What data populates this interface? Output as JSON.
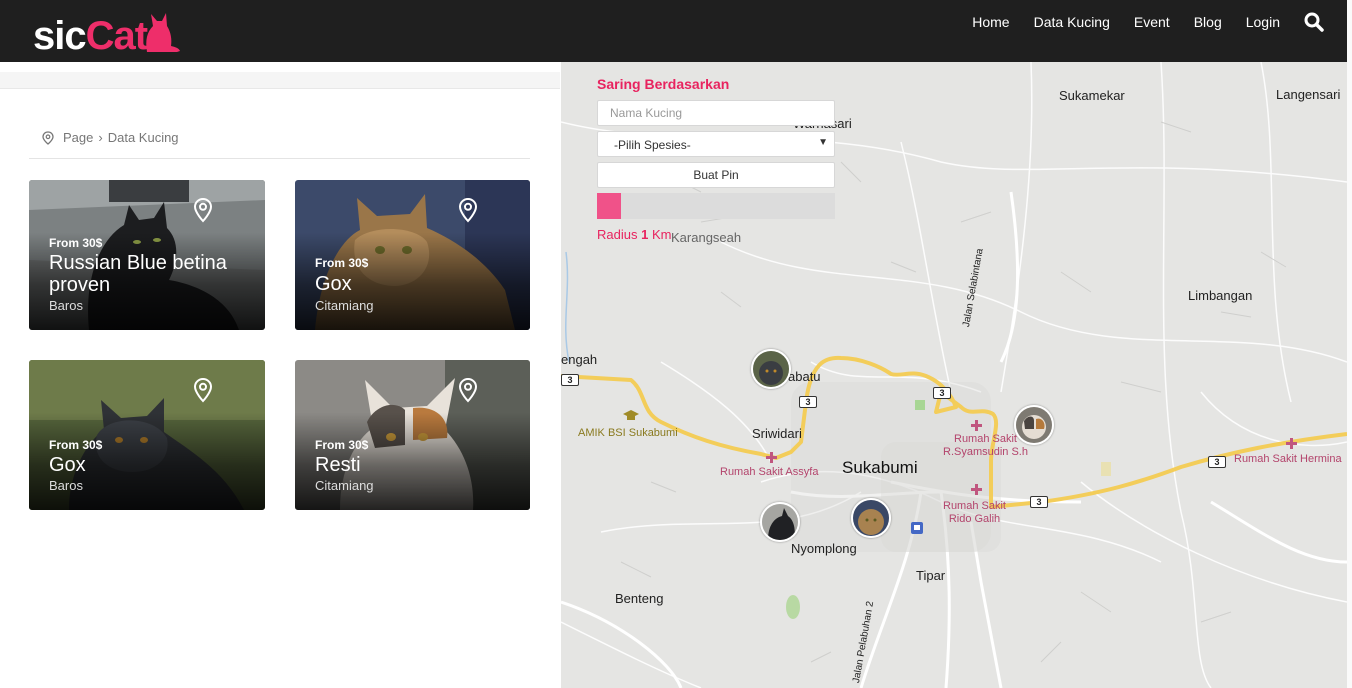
{
  "brand": {
    "name_white": "sic",
    "name_pink": "Cat"
  },
  "nav": {
    "items": [
      "Home",
      "Data Kucing",
      "Event",
      "Blog",
      "Login"
    ]
  },
  "breadcrumb": {
    "root": "Page",
    "separator": "›",
    "current": "Data Kucing"
  },
  "cards": [
    {
      "price": "From 30$",
      "title": "Russian Blue betina proven",
      "location": "Baros"
    },
    {
      "price": "From 30$",
      "title": "Gox",
      "location": "Citamiang"
    },
    {
      "price": "From 30$",
      "title": "Gox",
      "location": "Baros"
    },
    {
      "price": "From 30$",
      "title": "Resti",
      "location": "Citamiang"
    }
  ],
  "filter": {
    "heading": "Saring Berdasarkan",
    "name_placeholder": "Nama Kucing",
    "species_selected": "-Pilih Spesies-",
    "pin_button": "Buat Pin",
    "radius_prefix": "Radius",
    "radius_value": "1",
    "radius_unit": "Km",
    "radius_fill_fraction": 0.1
  },
  "map": {
    "places": {
      "sukamekar": "Sukamekar",
      "langensari": "Langensari",
      "warnasari": "Warnasari",
      "karangseah": "Karangseah",
      "limbangan": "Limbangan",
      "tengah": "engah",
      "cibatu": "abatu",
      "sriwidari": "Sriwidari",
      "sukabumi": "Sukabumi",
      "nyomplong": "Nyomplong",
      "tipar": "Tipar",
      "benteng": "Benteng",
      "jalan_selabintana": "Jalan Selabintana",
      "jalan_pelabuhan": "Jalan Pelabuhan 2"
    },
    "pois": {
      "amik": "AMIK BSI Sukabumi",
      "rs_syamsudin_1": "Rumah Sakit",
      "rs_syamsudin_2": "R.Syamsudin S.h",
      "rs_assyfa": "Rumah Sakit Assyfa",
      "rs_hermina": "Rumah Sakit Hermina",
      "rs_rido_1": "Rumah Sakit",
      "rs_rido_2": "Rido Galih"
    },
    "route_number": "3"
  },
  "colors": {
    "accent": "#ee2e6a",
    "navbar": "#1f1f1f",
    "road": "#f3cd5a"
  }
}
